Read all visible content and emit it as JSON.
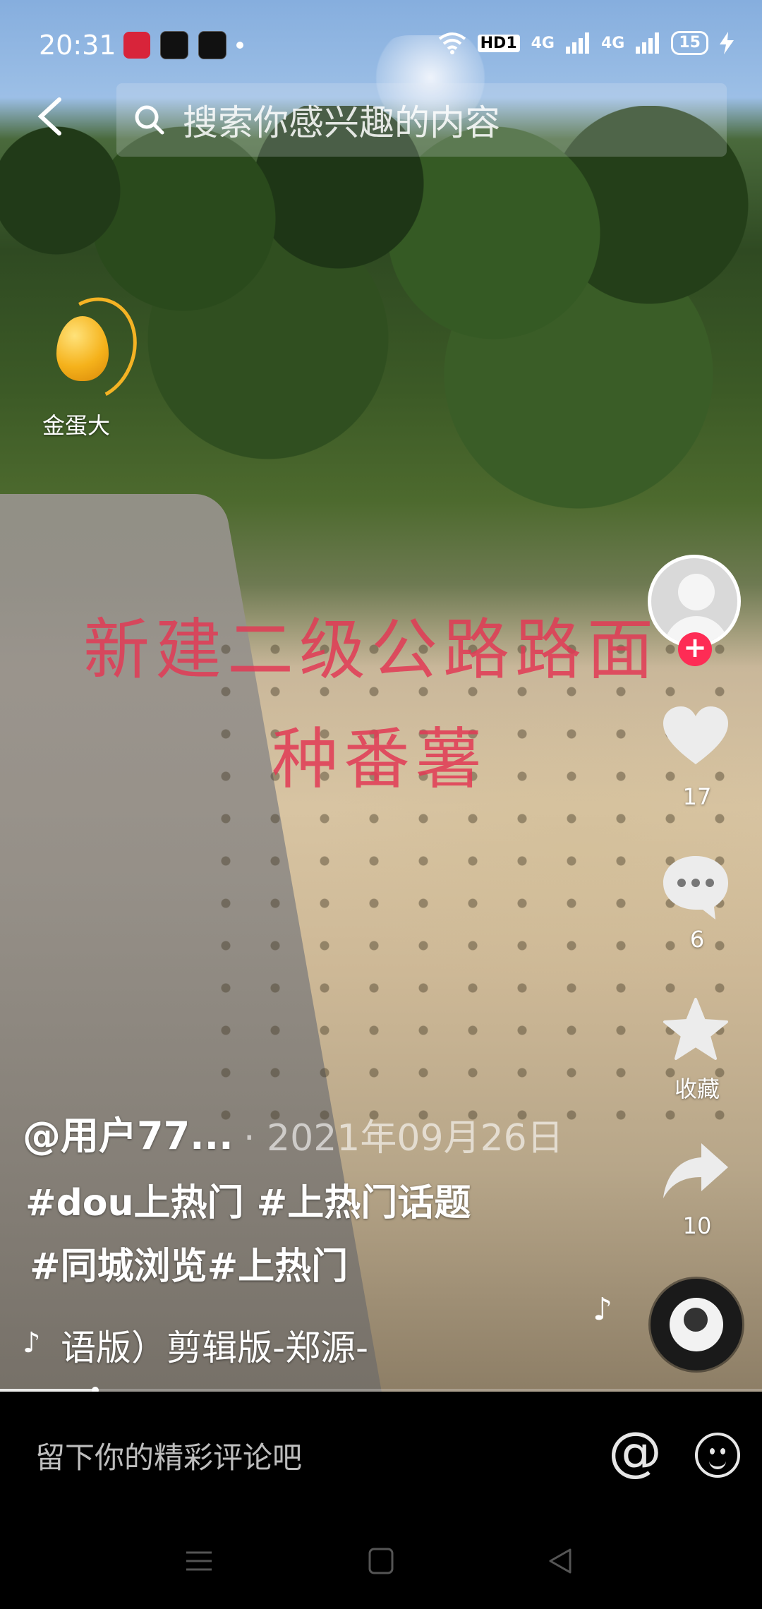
{
  "status_bar": {
    "time": "20:31",
    "hd_label": "HD1",
    "signal1_label": "4G",
    "signal2_label": "4G",
    "battery": "15"
  },
  "search": {
    "placeholder": "搜索你感兴趣的内容"
  },
  "video_overlay": {
    "line1": "新建二级公路路面",
    "line2": "种番薯"
  },
  "creator_badge": {
    "label": "金蛋大"
  },
  "rail": {
    "like_count": "17",
    "comment_count": "6",
    "favorite_label": "收藏",
    "share_count": "10"
  },
  "caption": {
    "author": "@用户77...",
    "date": "· 2021年09月26日",
    "tags_line1": "#dou上热门 #上热门话题",
    "tags_line2": "#同城浏览#上热门",
    "music": "语版）剪辑版-郑源-"
  },
  "progress_fraction": 0.125,
  "comment_bar": {
    "placeholder": "留下你的精彩评论吧",
    "at_symbol": "@"
  },
  "icons": [
    "back-icon",
    "search-icon",
    "heart-icon",
    "comment-icon",
    "star-icon",
    "share-icon",
    "music-disc-icon",
    "emoji-icon",
    "menu-icon",
    "home-icon",
    "back-triangle-icon"
  ],
  "colors": {
    "accent_red": "#fe2c55",
    "overlay_text": "#e23a55",
    "egg_gold": "#f5b21b"
  }
}
